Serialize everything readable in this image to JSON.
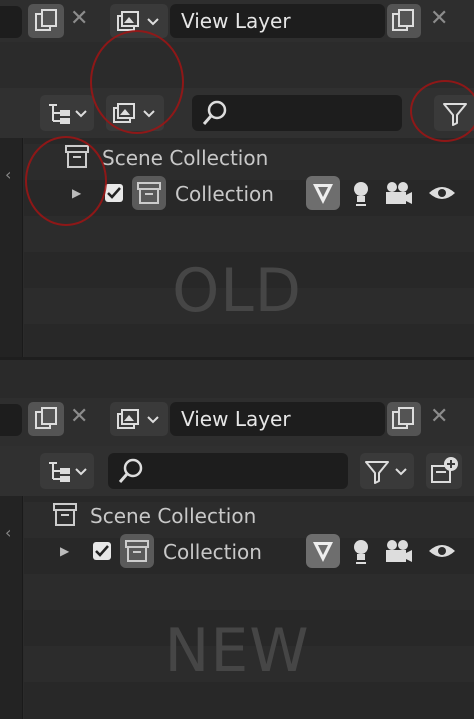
{
  "old": {
    "view_layer": "View Layer",
    "scene_collection": "Scene Collection",
    "collection": "Collection",
    "watermark": "OLD"
  },
  "new": {
    "view_layer": "View Layer",
    "scene_collection": "Scene Collection",
    "collection": "Collection",
    "watermark": "NEW"
  },
  "colors": {
    "annotation_circle": "#a01414",
    "panel_bg": "#2b2b2b",
    "field_bg": "#1d1d1d"
  }
}
